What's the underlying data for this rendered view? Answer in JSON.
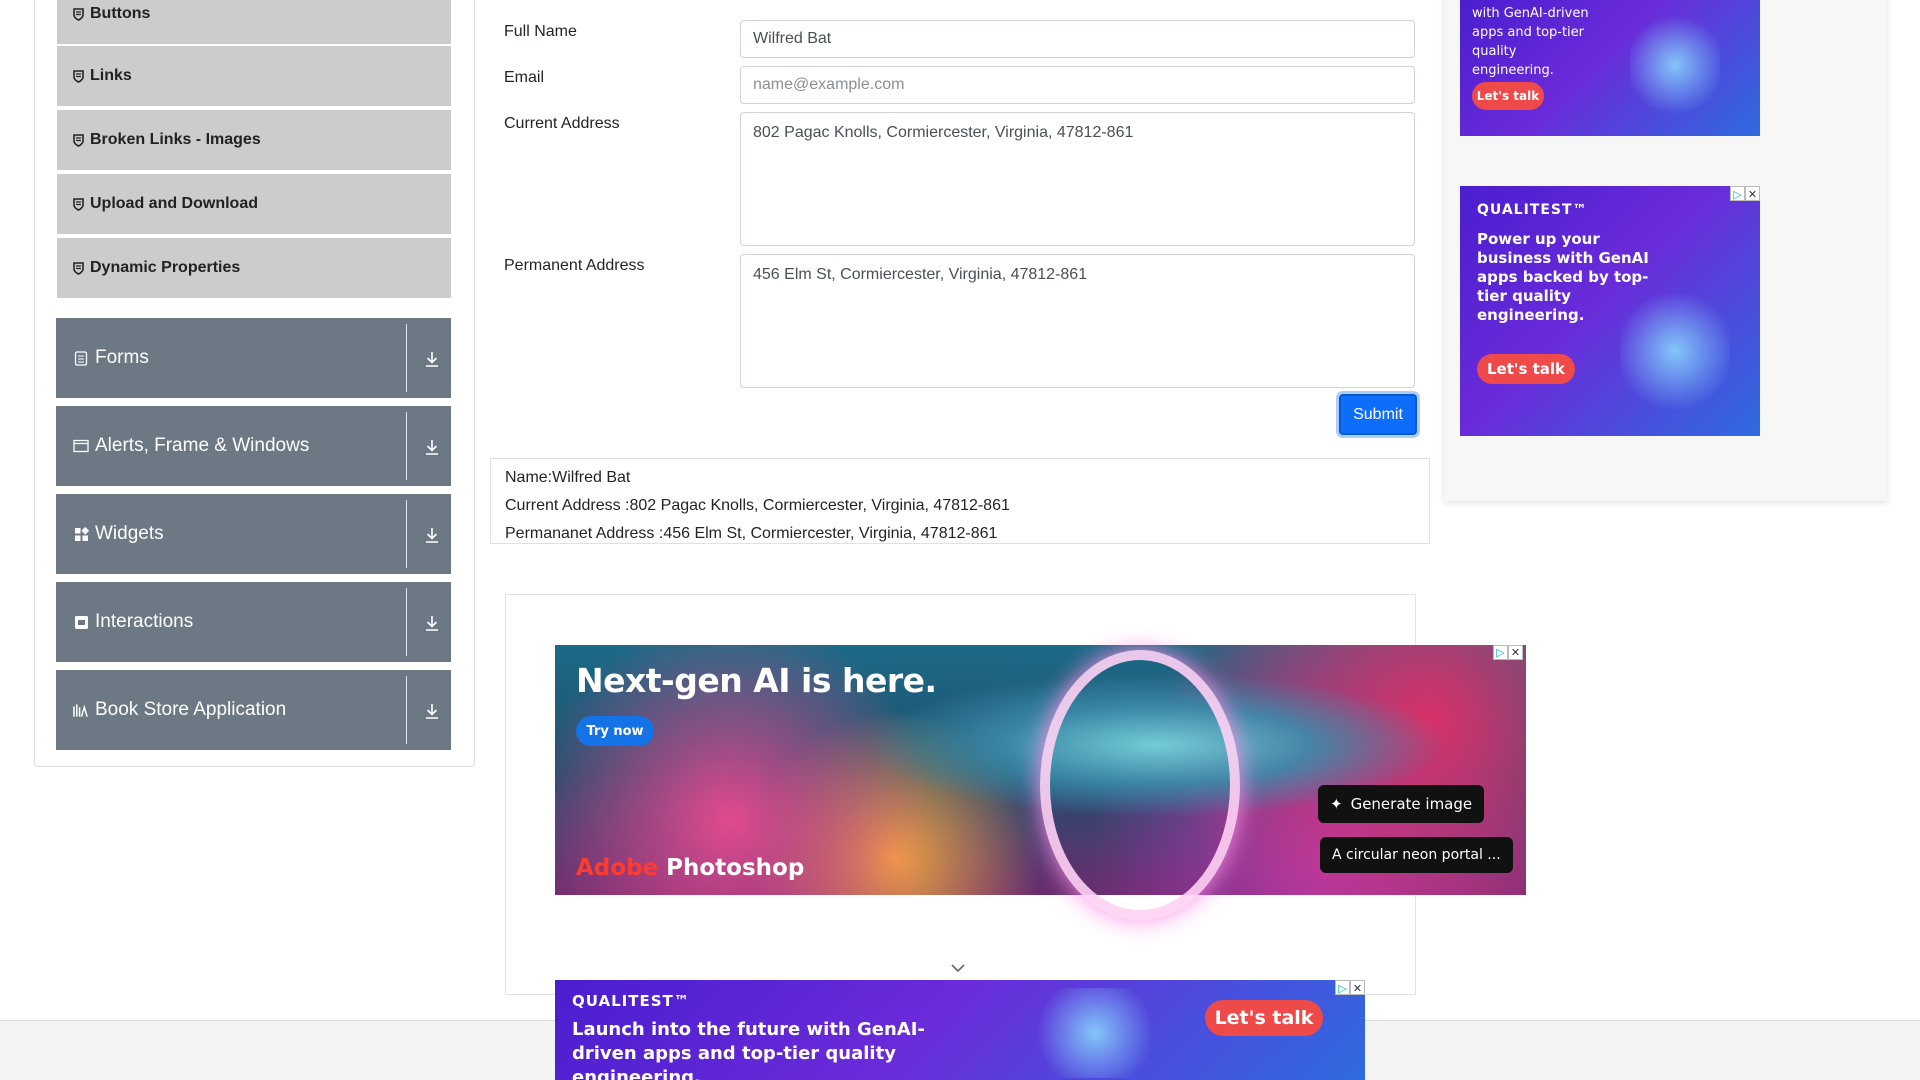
{
  "sidebar": {
    "sub_items": [
      {
        "label": "Buttons"
      },
      {
        "label": "Links"
      },
      {
        "label": "Broken Links - Images"
      },
      {
        "label": "Upload and Download"
      },
      {
        "label": "Dynamic Properties"
      }
    ],
    "groups": [
      {
        "label": "Forms",
        "icon": "form-icon"
      },
      {
        "label": "Alerts, Frame & Windows",
        "icon": "window-icon"
      },
      {
        "label": "Widgets",
        "icon": "widgets-icon"
      },
      {
        "label": "Interactions",
        "icon": "interactions-icon"
      },
      {
        "label": "Book Store Application",
        "icon": "book-icon"
      }
    ]
  },
  "form": {
    "full_name_label": "Full Name",
    "full_name_value": "Wilfred Bat",
    "email_label": "Email",
    "email_placeholder": "name@example.com",
    "current_address_label": "Current Address",
    "current_address_value": "802 Pagac Knolls, Cormiercester, Virginia, 47812-861",
    "permanent_address_label": "Permanent Address",
    "permanent_address_value": "456 Elm St, Cormiercester, Virginia, 47812-861",
    "submit_label": "Submit"
  },
  "output": {
    "name_line": "Name:Wilfred Bat",
    "current_line": "Current Address :802 Pagac Knolls, Cormiercester, Virginia, 47812-861",
    "permanent_line": "Permananet Address :456 Elm St, Cormiercester, Virginia, 47812-861"
  },
  "ads": {
    "top_right": {
      "text": "with GenAI-driven apps and top-tier quality engineering.",
      "cta": "Let's talk"
    },
    "right": {
      "brand": "QUALITEST™",
      "text": "Power up your business with GenAI apps backed by top-tier quality engineering.",
      "cta": "Let's talk"
    },
    "photoshop": {
      "headline": "Next-gen AI is here.",
      "cta": "Try now",
      "brand_adobe": "Adobe",
      "brand_product": "Photoshop",
      "chip_generate": "Generate image",
      "chip_prompt": "A circular neon portal ..."
    },
    "bottom": {
      "brand": "QUALITEST™",
      "text": "Launch into the future with GenAI-driven apps and top-tier quality engineering.",
      "cta": "Let's talk"
    },
    "adchoices_glyph": "▷",
    "close_glyph": "✕"
  },
  "colors": {
    "sidebar_group_bg": "#6c7883",
    "sub_item_bg": "#cccccc",
    "submit_bg": "#0d6efd",
    "cta_red": "#ee4a4a"
  }
}
